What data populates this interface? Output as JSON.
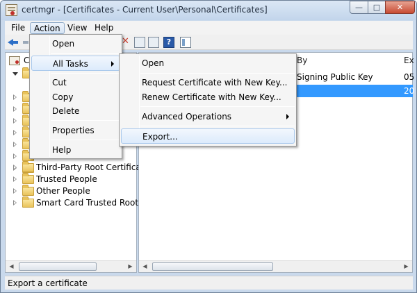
{
  "window": {
    "title": "certmgr - [Certificates - Current User\\Personal\\Certificates]"
  },
  "menubar": {
    "file": "File",
    "action": "Action",
    "view": "View",
    "help": "Help"
  },
  "toolbar": {
    "help_glyph": "?",
    "delete_glyph": "✕"
  },
  "tree": {
    "root_label": "Ce",
    "items": [
      {
        "label": "Third-Party Root Certification"
      },
      {
        "label": "Trusted People"
      },
      {
        "label": "Other People"
      },
      {
        "label": "Smart Card Trusted Roots"
      }
    ]
  },
  "list": {
    "col_issued_by": "By",
    "col_expiration": "Ex",
    "row1_issued_by": "Signing Public Key",
    "row1_expiration": "05",
    "row2_expiration": "20"
  },
  "action_menu": {
    "open": "Open",
    "all_tasks": "All Tasks",
    "cut": "Cut",
    "copy": "Copy",
    "delete": "Delete",
    "properties": "Properties",
    "help": "Help"
  },
  "all_tasks_menu": {
    "open": "Open",
    "request_new_key": "Request Certificate with New Key...",
    "renew_new_key": "Renew Certificate with New Key...",
    "advanced": "Advanced Operations",
    "export": "Export..."
  },
  "statusbar": {
    "text": "Export a certificate"
  }
}
